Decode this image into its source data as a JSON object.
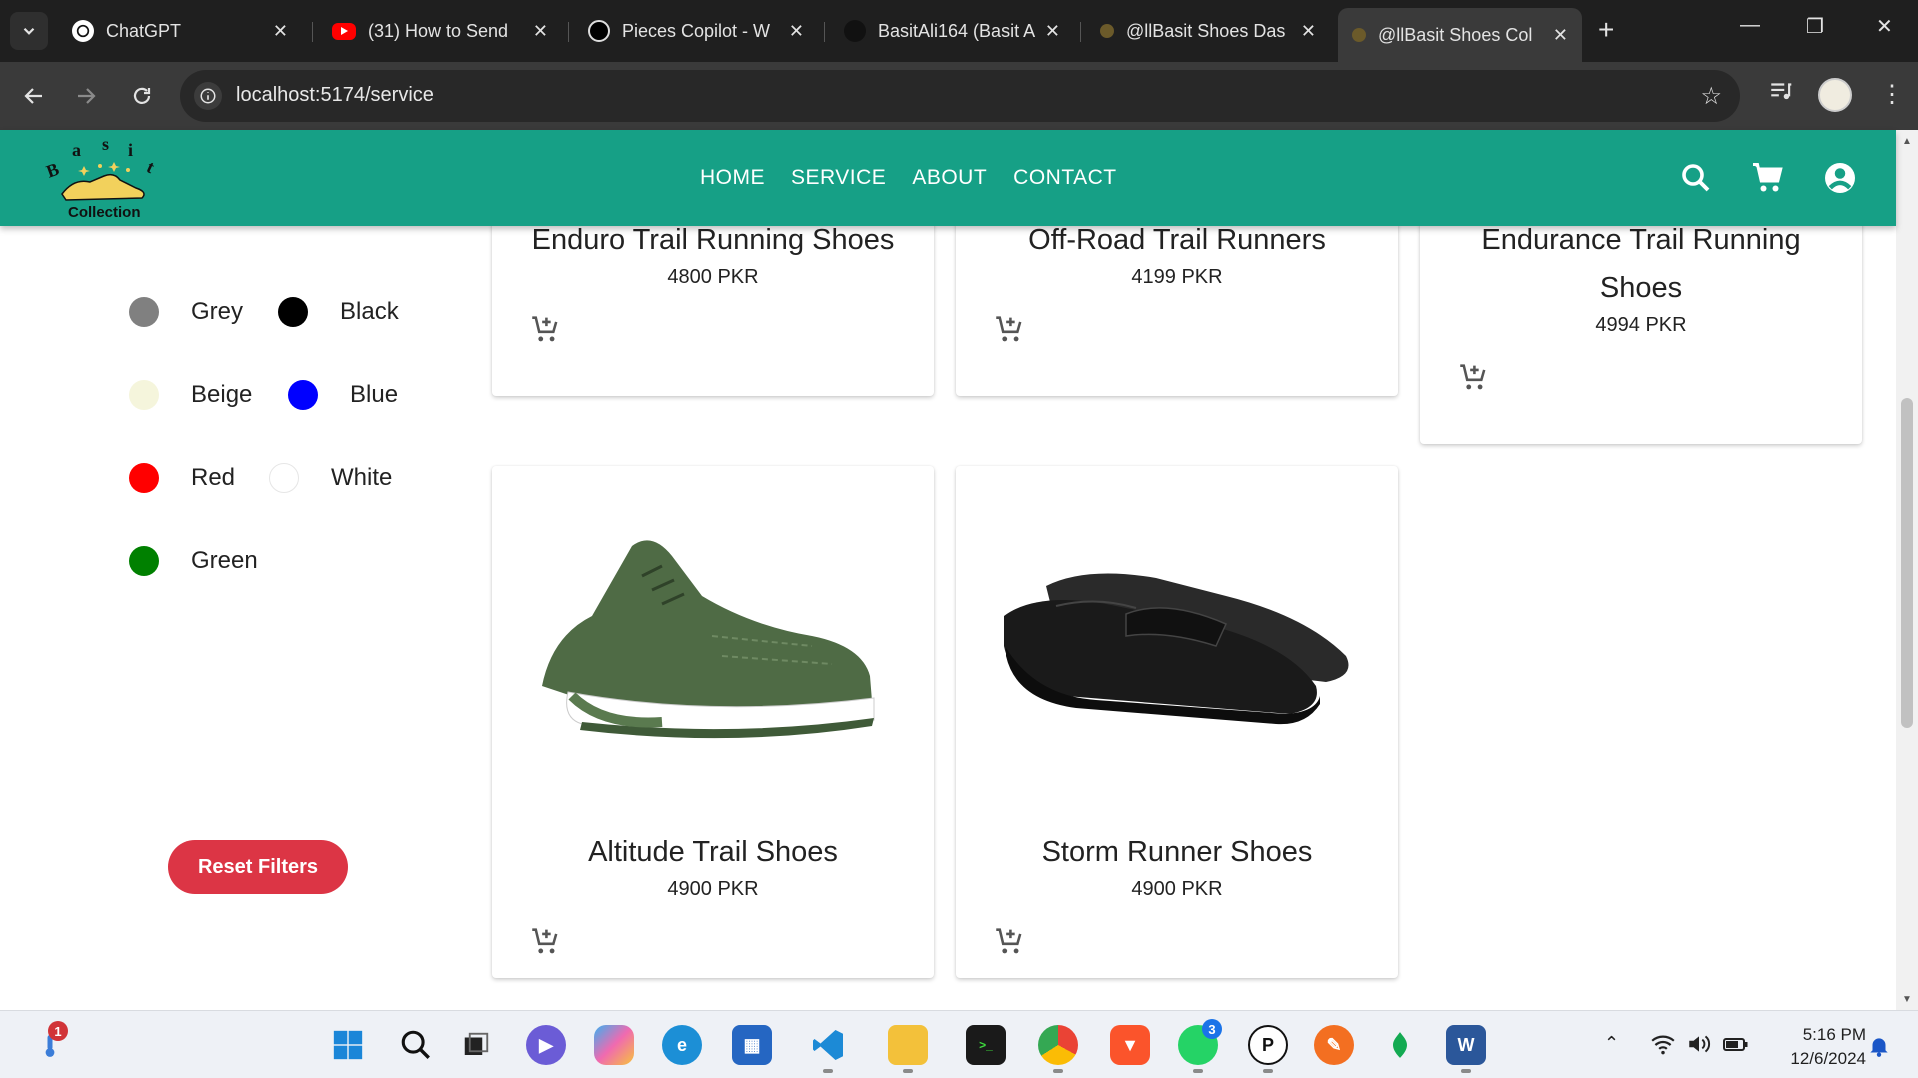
{
  "browser": {
    "tabs": [
      {
        "title": "ChatGPT",
        "icon": "chatgpt-icon"
      },
      {
        "title": "(31) How to Send",
        "icon": "youtube-icon"
      },
      {
        "title": "Pieces Copilot - W",
        "icon": "pieces-icon"
      },
      {
        "title": "BasitAli164 (Basit A",
        "icon": "github-icon"
      },
      {
        "title": "@llBasit Shoes Das",
        "icon": "site-icon"
      },
      {
        "title": "@llBasit Shoes Col",
        "icon": "site-icon",
        "active": true
      }
    ],
    "url": "localhost:5174/service",
    "new_tab": "+"
  },
  "header": {
    "logo_text": "Basit",
    "logo_sub": "Collection",
    "nav": [
      "HOME",
      "SERVICE",
      "ABOUT",
      "CONTACT"
    ],
    "accent": "#16a086"
  },
  "filters": {
    "colors": [
      {
        "name": "Grey",
        "hex": "#808080"
      },
      {
        "name": "Black",
        "hex": "#000000"
      },
      {
        "name": "Beige",
        "hex": "#f5f5dc"
      },
      {
        "name": "Blue",
        "hex": "#0000ff"
      },
      {
        "name": "Red",
        "hex": "#ff0000"
      },
      {
        "name": "White",
        "hex": "#ffffff"
      },
      {
        "name": "Green",
        "hex": "#008000"
      }
    ],
    "reset_label": "Reset Filters",
    "reset_color": "#dc3545"
  },
  "products": [
    {
      "name": "Enduro Trail Running Shoes",
      "price": "4800 PKR"
    },
    {
      "name": "Off-Road Trail Runners",
      "price": "4199 PKR"
    },
    {
      "name": "Endurance Trail Running",
      "name2": "Shoes",
      "price": "4994 PKR"
    },
    {
      "name": "Altitude Trail Shoes",
      "price": "4900 PKR",
      "image": "green-sneaker"
    },
    {
      "name": "Storm Runner Shoes",
      "price": "4900 PKR",
      "image": "black-loafer"
    }
  ],
  "taskbar": {
    "time": "5:16 PM",
    "date": "12/6/2024",
    "weather_badge": "1",
    "whatsapp_badge": "3"
  }
}
